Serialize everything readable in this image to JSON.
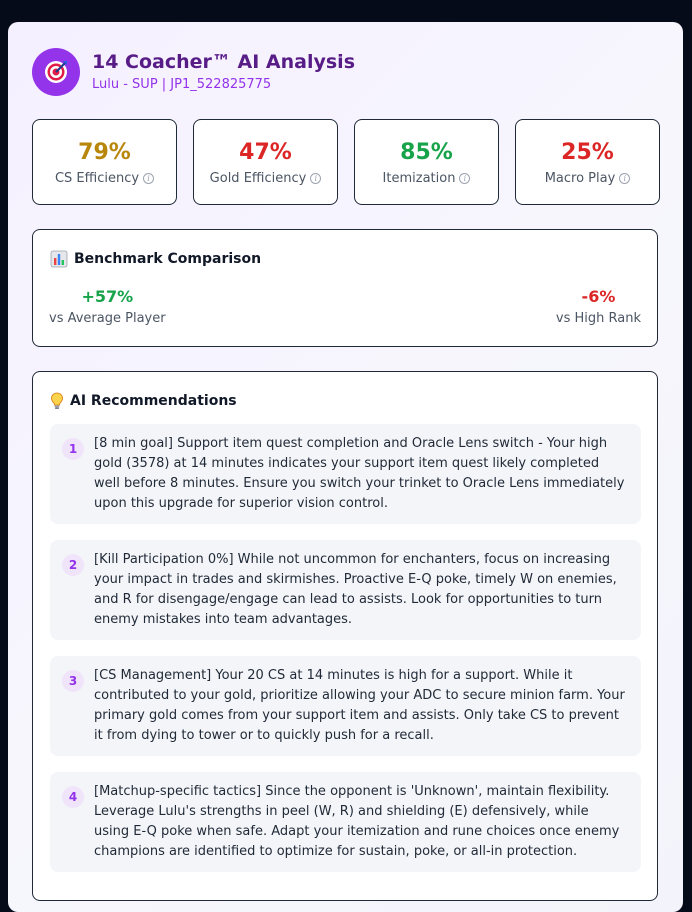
{
  "header": {
    "title": "14 Coacher™ AI Analysis",
    "subtitle": "Lulu - SUP | JP1_522825775",
    "logo_icon": "target-dart-icon"
  },
  "metrics": [
    {
      "value": "79%",
      "label": "CS Efficiency",
      "color": "#b8860b"
    },
    {
      "value": "47%",
      "label": "Gold Efficiency",
      "color": "#dc2626"
    },
    {
      "value": "85%",
      "label": "Itemization",
      "color": "#16a34a"
    },
    {
      "value": "25%",
      "label": "Macro Play",
      "color": "#dc2626"
    }
  ],
  "benchmark": {
    "title": "Benchmark Comparison",
    "icon": "bar-chart-icon",
    "left": {
      "value": "+57%",
      "label": "vs Average Player",
      "color": "#16a34a"
    },
    "right": {
      "value": "-6%",
      "label": "vs High Rank",
      "color": "#dc2626"
    }
  },
  "recommendations": {
    "title": "AI Recommendations",
    "icon": "lightbulb-icon",
    "items": [
      {
        "num": "1",
        "text": "[8 min goal] Support item quest completion and Oracle Lens switch - Your high gold (3578) at 14 minutes indicates your support item quest likely completed well before 8 minutes. Ensure you switch your trinket to Oracle Lens immediately upon this upgrade for superior vision control."
      },
      {
        "num": "2",
        "text": "[Kill Participation 0%] While not uncommon for enchanters, focus on increasing your impact in trades and skirmishes. Proactive E-Q poke, timely W on enemies, and R for disengage/engage can lead to assists. Look for opportunities to turn enemy mistakes into team advantages."
      },
      {
        "num": "3",
        "text": "[CS Management] Your 20 CS at 14 minutes is high for a support. While it contributed to your gold, prioritize allowing your ADC to secure minion farm. Your primary gold comes from your support item and assists. Only take CS to prevent it from dying to tower or to quickly push for a recall."
      },
      {
        "num": "4",
        "text": "[Matchup-specific tactics] Since the opponent is 'Unknown', maintain flexibility. Leverage Lulu's strengths in peel (W, R) and shielding (E) defensively, while using E-Q poke when safe. Adapt your itemization and rune choices once enemy champions are identified to optimize for sustain, poke, or all-in protection."
      }
    ]
  }
}
